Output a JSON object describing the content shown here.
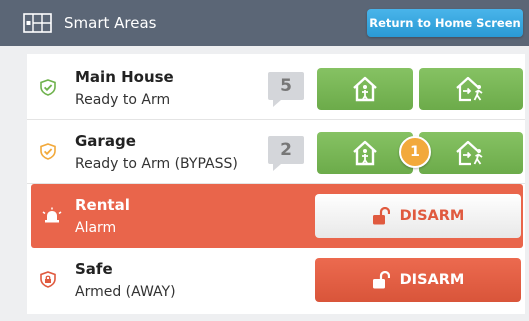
{
  "header": {
    "title": "Smart Areas",
    "home_button": "Return to Home Screen"
  },
  "areas": [
    {
      "name": "Main House",
      "status": "Ready to Arm",
      "count": "5",
      "state": "ready",
      "shield_color": "#6fb24d"
    },
    {
      "name": "Garage",
      "status": "Ready to Arm (BYPASS)",
      "count": "2",
      "bypass_count": "1",
      "state": "ready",
      "shield_color": "#f2a93b"
    },
    {
      "name": "Rental",
      "status": "Alarm",
      "state": "alarm",
      "action": "DISARM"
    },
    {
      "name": "Safe",
      "status": "Armed (AWAY)",
      "state": "armed",
      "action": "DISARM",
      "shield_color": "#e05a3f"
    }
  ],
  "colors": {
    "header_bg": "#5b6676",
    "home_button": "#2a9ad4",
    "arm_green": "#6cab4a",
    "alarm_red": "#e9654b",
    "bypass_orange": "#f2a93b"
  },
  "icons": {
    "header": "smart-areas-grid-icon",
    "stay": "arm-stay-house-icon",
    "away": "arm-away-house-icon",
    "disarm": "unlocked-padlock-icon",
    "alarm": "siren-icon"
  }
}
